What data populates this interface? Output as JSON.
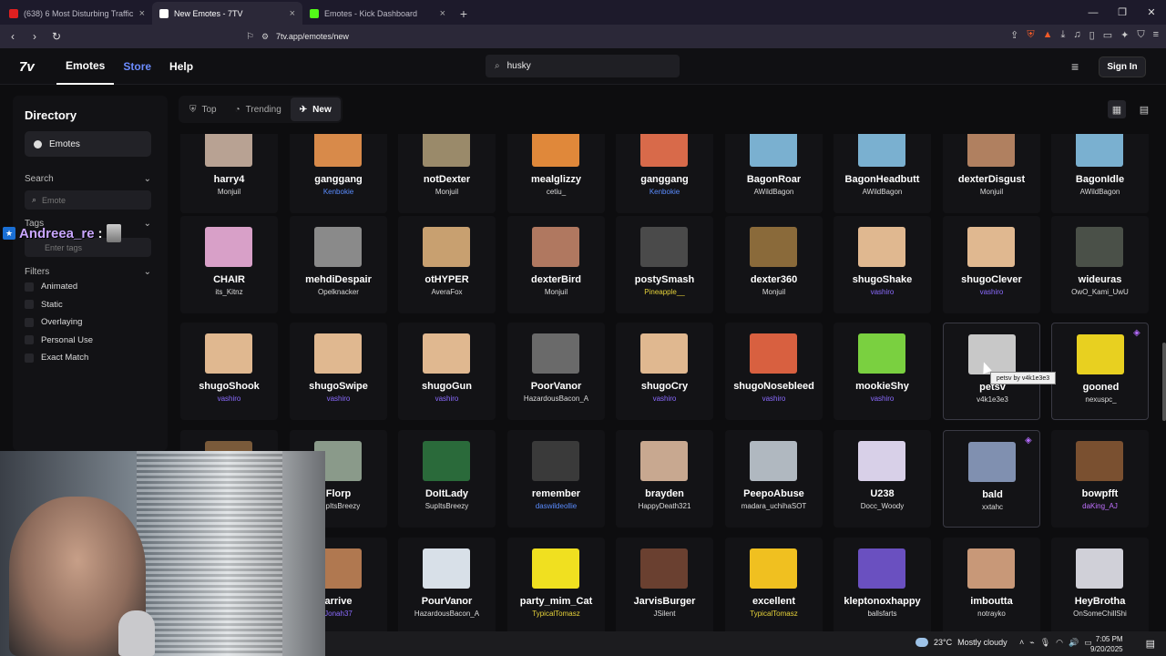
{
  "browser": {
    "tabs": [
      {
        "title": "(638) 6 Most Disturbing Traffic Stops",
        "color": "#e02020",
        "active": false
      },
      {
        "title": "New Emotes - 7TV",
        "color": "#ffffff",
        "active": true
      },
      {
        "title": "Emotes - Kick Dashboard",
        "color": "#53fc18",
        "active": false
      }
    ],
    "url": "7tv.app/emotes/new"
  },
  "header": {
    "logo": "7v",
    "nav": [
      {
        "label": "Emotes",
        "active": true
      },
      {
        "label": "Store",
        "active": false
      },
      {
        "label": "Help",
        "active": false
      }
    ],
    "search_value": "husky",
    "signin_label": "Sign In"
  },
  "sidebar": {
    "title": "Directory",
    "emotes_label": "Emotes",
    "search_label": "Search",
    "search_placeholder": "Emote",
    "tags_label": "Tags",
    "tags_placeholder": "Enter tags",
    "filters_label": "Filters",
    "filters": [
      "Animated",
      "Static",
      "Overlaying",
      "Personal Use",
      "Exact Match"
    ]
  },
  "chat_overlay": {
    "name": "Andreea_re",
    "sep": ":"
  },
  "sort_tabs": [
    {
      "label": "Top",
      "active": false
    },
    {
      "label": "Trending",
      "active": false
    },
    {
      "label": "New",
      "active": true
    }
  ],
  "emote_rows": [
    [
      {
        "name": "harry4",
        "author": "Monjuil",
        "style": "",
        "color": "#b8a293"
      },
      {
        "name": "ganggang",
        "author": "Kenbokie",
        "style": "blue",
        "color": "#d88a4a"
      },
      {
        "name": "notDexter",
        "author": "Monjuil",
        "style": "",
        "color": "#9a8a6a"
      },
      {
        "name": "mealglizzy",
        "author": "cetiu_",
        "style": "",
        "color": "#e0883a"
      },
      {
        "name": "ganggang",
        "author": "Kenbokie",
        "style": "blue",
        "color": "#d86a4a"
      },
      {
        "name": "BagonRoar",
        "author": "AWildBagon",
        "style": "",
        "color": "#7ab0d0"
      },
      {
        "name": "BagonHeadbutt",
        "author": "AWildBagon",
        "style": "",
        "color": "#7ab0d0"
      },
      {
        "name": "dexterDisgust",
        "author": "Monjuil",
        "style": "",
        "color": "#b08060"
      },
      {
        "name": "BagonIdle",
        "author": "AWildBagon",
        "style": "",
        "color": "#7ab0d0"
      }
    ],
    [
      {
        "name": "CHAIR",
        "author": "its_Kitnz",
        "style": "",
        "color": "#d8a0c8"
      },
      {
        "name": "mehdiDespair",
        "author": "Opelknacker",
        "style": "",
        "color": "#8a8a8a"
      },
      {
        "name": "otHYPER",
        "author": "AveraFox",
        "style": "",
        "color": "#c8a070"
      },
      {
        "name": "dexterBird",
        "author": "Monjuil",
        "style": "",
        "color": "#b07860"
      },
      {
        "name": "postySmash",
        "author": "Pineapple__",
        "style": "yellow",
        "color": "#4a4a4a"
      },
      {
        "name": "dexter360",
        "author": "Monjuil",
        "style": "",
        "color": "#8a6a3a"
      },
      {
        "name": "shugoShake",
        "author": "vashiro",
        "style": "purple",
        "color": "#e0b890"
      },
      {
        "name": "shugoClever",
        "author": "vashiro",
        "style": "purple",
        "color": "#e0b890"
      },
      {
        "name": "wideuras",
        "author": "OwO_Kami_UwU",
        "style": "",
        "color": "#4a5048"
      }
    ],
    [
      {
        "name": "shugoShook",
        "author": "vashiro",
        "style": "purple",
        "color": "#e0b890"
      },
      {
        "name": "shugoSwipe",
        "author": "vashiro",
        "style": "purple",
        "color": "#e0b890"
      },
      {
        "name": "shugoGun",
        "author": "vashiro",
        "style": "purple",
        "color": "#e0b890"
      },
      {
        "name": "PoorVanor",
        "author": "HazardousBacon_A",
        "style": "",
        "color": "#6a6a6a"
      },
      {
        "name": "shugoCry",
        "author": "vashiro",
        "style": "purple",
        "color": "#e0b890"
      },
      {
        "name": "shugoNosebleed",
        "author": "vashiro",
        "style": "purple",
        "color": "#d86040"
      },
      {
        "name": "mookieShy",
        "author": "vashiro",
        "style": "purple",
        "color": "#7ad040"
      },
      {
        "name": "petsv",
        "author": "v4k1e3e3",
        "style": "",
        "color": "#c8c8c8"
      },
      {
        "name": "gooned",
        "author": "nexuspc_",
        "style": "",
        "color": "#e8d020"
      }
    ],
    [
      {
        "name": "",
        "author": "",
        "style": "",
        "color": "#7a5a3a"
      },
      {
        "name": "Florp",
        "author": "SupItsBreezy",
        "style": "",
        "color": "#8a9a8a"
      },
      {
        "name": "DoItLady",
        "author": "SupItsBreezy",
        "style": "",
        "color": "#2a6a3a"
      },
      {
        "name": "remember",
        "author": "daswildeollie",
        "style": "blue",
        "color": "#3a3a3a"
      },
      {
        "name": "brayden",
        "author": "HappyDeath321",
        "style": "",
        "color": "#c8a890"
      },
      {
        "name": "PeepoAbuse",
        "author": "madara_uchihaSOT",
        "style": "",
        "color": "#b0b8c0"
      },
      {
        "name": "U238",
        "author": "Docc_Woody",
        "style": "",
        "color": "#d8d0e8"
      },
      {
        "name": "bald",
        "author": "xxtahc",
        "style": "",
        "color": "#8090b0"
      },
      {
        "name": "bowpfft",
        "author": "daKing_AJ",
        "style": "gradient",
        "color": "#7a5030"
      }
    ],
    [
      {
        "name": "",
        "author": "",
        "style": "",
        "color": "#6a4a3a"
      },
      {
        "name": "arrive",
        "author": "Jonah37",
        "style": "purple",
        "color": "#b07850"
      },
      {
        "name": "PourVanor",
        "author": "HazardousBacon_A",
        "style": "",
        "color": "#d8e0e8"
      },
      {
        "name": "party_mim_Cat",
        "author": "TypicalTomasz",
        "style": "yellow",
        "color": "#f0e020"
      },
      {
        "name": "JarvisBurger",
        "author": "JSilent",
        "style": "",
        "color": "#6a4030"
      },
      {
        "name": "excellent",
        "author": "TypicalTomasz",
        "style": "yellow",
        "color": "#f0c020"
      },
      {
        "name": "kleptonoxhappy",
        "author": "ballsfarts",
        "style": "",
        "color": "#6a50c0"
      },
      {
        "name": "imboutta",
        "author": "notrayko",
        "style": "",
        "color": "#c89878"
      },
      {
        "name": "HeyBrotha",
        "author": "OnSomeChillShi",
        "style": "",
        "color": "#d0d0d8"
      }
    ]
  ],
  "tooltip": "petsv by v4k1e3e3",
  "taskbar": {
    "temp": "23°C",
    "weather": "Mostly cloudy",
    "time": "7:05 PM",
    "date": "9/20/2025"
  }
}
